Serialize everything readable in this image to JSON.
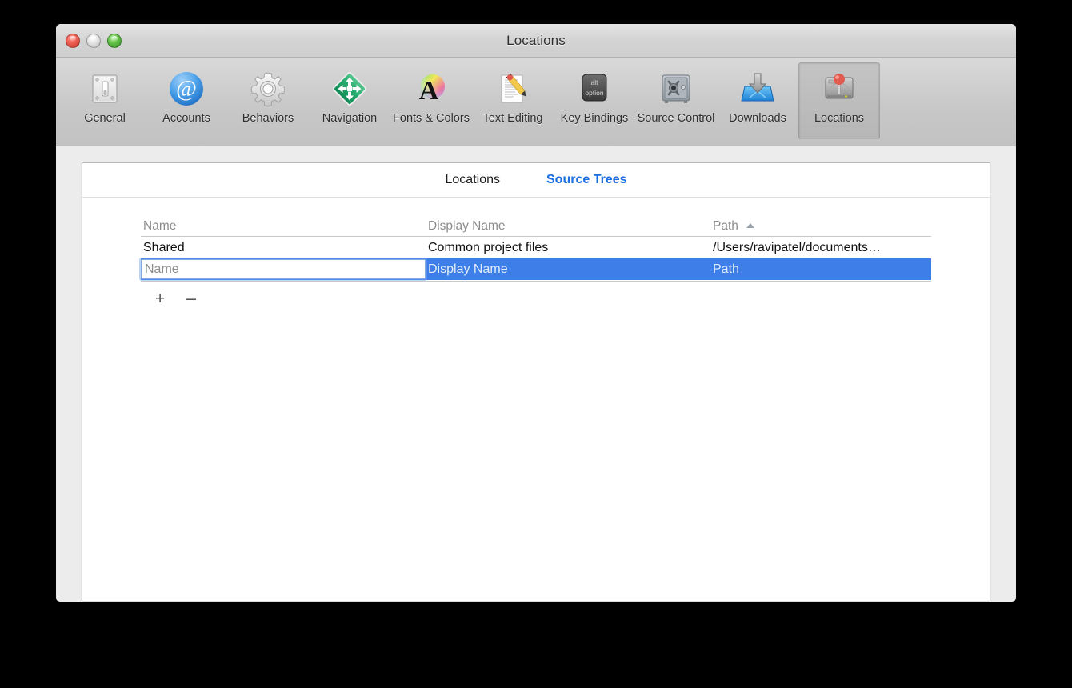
{
  "window": {
    "title": "Locations",
    "traffic_lights": [
      {
        "name": "close",
        "color": "#ef5f53"
      },
      {
        "name": "minimize",
        "color": "#e4e4e4"
      },
      {
        "name": "zoom",
        "color": "#62c045"
      }
    ]
  },
  "toolbar": {
    "items": [
      {
        "label": "General",
        "icon": "light-switch-icon",
        "selected": false
      },
      {
        "label": "Accounts",
        "icon": "at-sign-icon",
        "selected": false
      },
      {
        "label": "Behaviors",
        "icon": "gear-icon",
        "selected": false
      },
      {
        "label": "Navigation",
        "icon": "move-arrows-icon",
        "selected": false
      },
      {
        "label": "Fonts & Colors",
        "icon": "color-wheel-a-icon",
        "selected": false
      },
      {
        "label": "Text Editing",
        "icon": "document-pencil-icon",
        "selected": false
      },
      {
        "label": "Key Bindings",
        "icon": "alt-option-key-icon",
        "selected": false
      },
      {
        "label": "Source Control",
        "icon": "safe-icon",
        "selected": false
      },
      {
        "label": "Downloads",
        "icon": "download-tray-icon",
        "selected": false
      },
      {
        "label": "Locations",
        "icon": "hard-drive-pin-icon",
        "selected": true
      }
    ]
  },
  "pane": {
    "tabs": [
      {
        "label": "Locations",
        "active": false
      },
      {
        "label": "Source Trees",
        "active": true
      }
    ],
    "accent_color": "#1a6ee0",
    "selection_color": "#3d7ee8",
    "table": {
      "columns": [
        {
          "label": "Name",
          "sorted": false
        },
        {
          "label": "Display Name",
          "sorted": false
        },
        {
          "label": "Path",
          "sorted": true,
          "sort_direction": "ascending"
        }
      ],
      "rows": [
        {
          "name": "Shared",
          "display_name": "Common project files",
          "path": "/Users/ravipatel/documents…",
          "selected": false,
          "editing": false
        },
        {
          "name": "",
          "name_placeholder": "Name",
          "display_name": "Display Name",
          "path": "Path",
          "selected": true,
          "editing": true
        }
      ]
    },
    "controls": {
      "add_label": "+",
      "remove_label": "–"
    }
  }
}
